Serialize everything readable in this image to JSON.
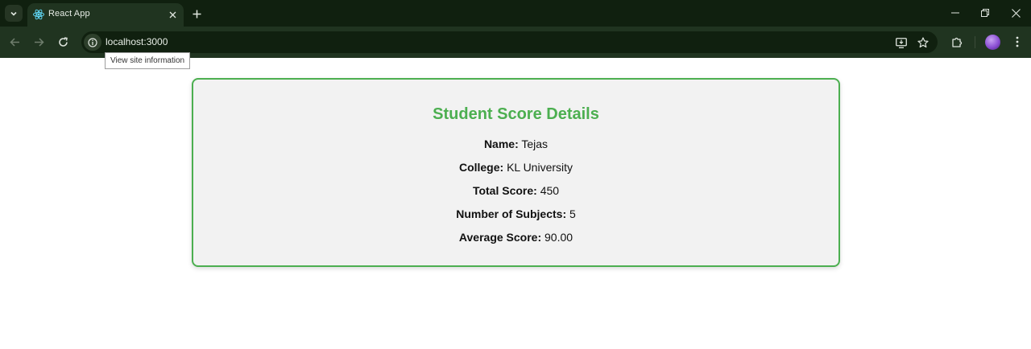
{
  "browser": {
    "tab_title": "React App",
    "url": "localhost:3000",
    "tooltip": "View site information"
  },
  "page": {
    "title": "Student Score Details",
    "details": [
      {
        "label": "Name:",
        "value": "Tejas"
      },
      {
        "label": "College:",
        "value": "KL University"
      },
      {
        "label": "Total Score:",
        "value": "450"
      },
      {
        "label": "Number of Subjects:",
        "value": "5"
      },
      {
        "label": "Average Score:",
        "value": "90.00"
      }
    ]
  },
  "colors": {
    "accent": "#4caf50",
    "card_background": "#f2f2f2",
    "chrome_background": "#10200f"
  },
  "icons": [
    "tab-search-icon",
    "react-logo-icon",
    "close-icon",
    "plus-icon",
    "minimize-icon",
    "restore-icon",
    "window-close-icon",
    "back-arrow-icon",
    "forward-arrow-icon",
    "reload-icon",
    "info-icon",
    "install-app-icon",
    "star-icon",
    "extensions-icon",
    "menu-icon"
  ]
}
